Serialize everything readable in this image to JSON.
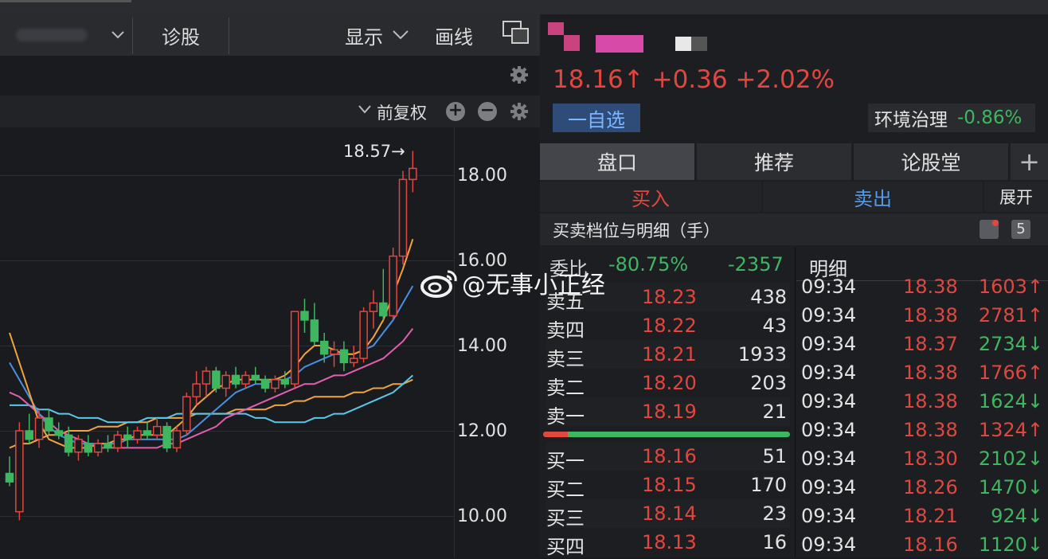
{
  "toolbar": {
    "stock_select": "",
    "diagnose": "诊股",
    "display": "显示",
    "draw": "画线"
  },
  "chart": {
    "adjust_mode": "前复权",
    "high_marker": "18.57→",
    "price_labels": [
      "18.00",
      "16.00",
      "14.00",
      "12.00",
      "10.00"
    ]
  },
  "chart_data": {
    "type": "candlestick",
    "y_axis_ticks": [
      18.0,
      16.0,
      14.0,
      12.0,
      10.0
    ],
    "high_annotation": 18.57,
    "candles": [
      {
        "o": 11.0,
        "h": 11.4,
        "l": 10.7,
        "c": 10.8
      },
      {
        "o": 10.1,
        "h": 12.2,
        "l": 9.9,
        "c": 12.0
      },
      {
        "o": 12.0,
        "h": 12.4,
        "l": 11.7,
        "c": 11.8
      },
      {
        "o": 11.8,
        "h": 12.5,
        "l": 11.6,
        "c": 12.3
      },
      {
        "o": 12.3,
        "h": 12.5,
        "l": 11.9,
        "c": 12.0
      },
      {
        "o": 12.0,
        "h": 12.2,
        "l": 11.8,
        "c": 11.9
      },
      {
        "o": 11.9,
        "h": 12.1,
        "l": 11.4,
        "c": 11.5
      },
      {
        "o": 11.5,
        "h": 11.9,
        "l": 11.3,
        "c": 11.8
      },
      {
        "o": 11.7,
        "h": 11.9,
        "l": 11.4,
        "c": 11.5
      },
      {
        "o": 11.5,
        "h": 11.8,
        "l": 11.4,
        "c": 11.7
      },
      {
        "o": 11.7,
        "h": 11.9,
        "l": 11.5,
        "c": 11.6
      },
      {
        "o": 11.6,
        "h": 12.0,
        "l": 11.5,
        "c": 11.9
      },
      {
        "o": 11.9,
        "h": 12.1,
        "l": 11.6,
        "c": 11.8
      },
      {
        "o": 11.8,
        "h": 12.1,
        "l": 11.7,
        "c": 12.0
      },
      {
        "o": 12.0,
        "h": 12.2,
        "l": 11.8,
        "c": 11.9
      },
      {
        "o": 11.9,
        "h": 12.3,
        "l": 11.8,
        "c": 12.1
      },
      {
        "o": 12.1,
        "h": 12.2,
        "l": 11.5,
        "c": 11.6
      },
      {
        "o": 11.6,
        "h": 12.1,
        "l": 11.5,
        "c": 12.0
      },
      {
        "o": 12.0,
        "h": 12.9,
        "l": 11.9,
        "c": 12.8
      },
      {
        "o": 12.8,
        "h": 13.4,
        "l": 12.6,
        "c": 13.1
      },
      {
        "o": 13.1,
        "h": 13.5,
        "l": 12.8,
        "c": 13.4
      },
      {
        "o": 13.4,
        "h": 13.5,
        "l": 12.9,
        "c": 13.0
      },
      {
        "o": 13.0,
        "h": 13.4,
        "l": 12.8,
        "c": 13.3
      },
      {
        "o": 13.3,
        "h": 13.5,
        "l": 13.0,
        "c": 13.1
      },
      {
        "o": 13.1,
        "h": 13.4,
        "l": 13.0,
        "c": 13.3
      },
      {
        "o": 13.3,
        "h": 13.5,
        "l": 13.1,
        "c": 13.2
      },
      {
        "o": 13.2,
        "h": 13.3,
        "l": 12.9,
        "c": 13.0
      },
      {
        "o": 13.0,
        "h": 13.3,
        "l": 12.9,
        "c": 13.2
      },
      {
        "o": 13.2,
        "h": 13.4,
        "l": 13.0,
        "c": 13.1
      },
      {
        "o": 13.1,
        "h": 14.8,
        "l": 13.0,
        "c": 14.8
      },
      {
        "o": 14.8,
        "h": 15.1,
        "l": 14.3,
        "c": 14.6
      },
      {
        "o": 14.6,
        "h": 15.0,
        "l": 14.0,
        "c": 14.1
      },
      {
        "o": 14.1,
        "h": 14.3,
        "l": 13.6,
        "c": 13.8
      },
      {
        "o": 13.8,
        "h": 14.1,
        "l": 13.5,
        "c": 13.9
      },
      {
        "o": 13.9,
        "h": 14.1,
        "l": 13.4,
        "c": 13.6
      },
      {
        "o": 13.6,
        "h": 14.0,
        "l": 13.5,
        "c": 13.7
      },
      {
        "o": 13.7,
        "h": 14.9,
        "l": 13.6,
        "c": 14.8
      },
      {
        "o": 14.8,
        "h": 15.3,
        "l": 14.4,
        "c": 15.0
      },
      {
        "o": 15.0,
        "h": 15.8,
        "l": 14.6,
        "c": 14.7
      },
      {
        "o": 14.7,
        "h": 16.3,
        "l": 14.6,
        "c": 16.1
      },
      {
        "o": 16.1,
        "h": 18.1,
        "l": 15.9,
        "c": 17.9
      },
      {
        "o": 17.9,
        "h": 18.57,
        "l": 17.6,
        "c": 18.16
      }
    ],
    "ma_lines": [
      {
        "color": "#f0a341",
        "values": [
          11.6,
          11.7,
          11.7,
          11.8,
          11.9,
          11.9,
          12.0,
          12.0,
          12.0,
          12.1,
          12.1,
          12.1,
          12.2,
          12.2,
          12.2,
          12.3,
          12.3,
          12.3,
          12.3,
          12.4,
          12.4,
          12.4,
          12.4,
          12.5,
          12.5,
          12.5,
          12.5,
          12.6,
          12.6,
          12.7,
          12.7,
          12.8,
          12.8,
          12.8,
          12.8,
          12.9,
          12.9,
          13.0,
          13.0,
          13.1,
          13.1,
          13.2
        ]
      },
      {
        "color": "#5ac8e8",
        "values": [
          12.6,
          12.6,
          12.6,
          12.5,
          12.5,
          12.4,
          12.4,
          12.3,
          12.3,
          12.3,
          12.2,
          12.2,
          12.2,
          12.2,
          12.3,
          12.3,
          12.3,
          12.4,
          12.4,
          12.4,
          12.4,
          12.4,
          12.4,
          12.4,
          12.4,
          12.3,
          12.3,
          12.2,
          12.2,
          12.2,
          12.2,
          12.3,
          12.3,
          12.4,
          12.4,
          12.5,
          12.6,
          12.7,
          12.8,
          12.9,
          13.1,
          13.3
        ]
      },
      {
        "color": "#e05fb0",
        "values": [
          12.9,
          12.8,
          12.6,
          12.4,
          12.2,
          12.0,
          11.9,
          11.8,
          11.7,
          11.6,
          11.6,
          11.6,
          11.6,
          11.6,
          11.6,
          11.6,
          11.7,
          11.7,
          11.8,
          11.9,
          12.0,
          12.1,
          12.3,
          12.4,
          12.5,
          12.6,
          12.7,
          12.8,
          12.9,
          13.0,
          13.1,
          13.1,
          13.2,
          13.3,
          13.3,
          13.4,
          13.5,
          13.6,
          13.7,
          13.9,
          14.1,
          14.4
        ]
      },
      {
        "color": "#4a90e2",
        "values": [
          13.6,
          13.2,
          12.8,
          12.4,
          12.1,
          11.9,
          11.8,
          11.7,
          11.7,
          11.7,
          11.7,
          11.7,
          11.8,
          11.8,
          11.8,
          11.8,
          11.8,
          11.8,
          11.9,
          12.1,
          12.3,
          12.5,
          12.7,
          12.9,
          13.0,
          13.1,
          13.1,
          13.2,
          13.2,
          13.3,
          13.5,
          13.6,
          13.7,
          13.8,
          13.8,
          13.8,
          13.9,
          14.0,
          14.3,
          14.6,
          15.0,
          15.4
        ]
      },
      {
        "color": "#f0a341",
        "values": [
          14.3,
          13.6,
          12.9,
          12.2,
          11.8,
          11.7,
          11.6,
          11.6,
          11.6,
          11.7,
          11.7,
          11.8,
          11.8,
          11.9,
          11.9,
          11.9,
          11.9,
          12.1,
          12.3,
          12.6,
          12.8,
          13.0,
          13.1,
          13.2,
          13.2,
          13.2,
          13.2,
          13.2,
          13.3,
          13.5,
          13.8,
          14.0,
          14.0,
          13.9,
          13.8,
          13.8,
          13.9,
          14.2,
          14.6,
          15.2,
          15.8,
          16.5
        ]
      }
    ]
  },
  "quote": {
    "price": "18.16↑",
    "change": "+0.36",
    "change_pct": "+2.02%",
    "watchlist_button": "一自选",
    "sector_name": "环境治理",
    "sector_change": "-0.86%"
  },
  "tabs": [
    "盘口",
    "推荐",
    "论股堂"
  ],
  "trade": {
    "buy": "买入",
    "sell": "卖出",
    "expand": "展开"
  },
  "order_book": {
    "title": "买卖档位与明细（手）",
    "level_count": "5",
    "weibi_label": "委比",
    "weibi_pct": "-80.75%",
    "weibi_value": "-2357",
    "asks": [
      {
        "label": "卖五",
        "price": "18.23",
        "vol": "438"
      },
      {
        "label": "卖四",
        "price": "18.22",
        "vol": "43"
      },
      {
        "label": "卖三",
        "price": "18.21",
        "vol": "1933"
      },
      {
        "label": "卖二",
        "price": "18.20",
        "vol": "203"
      },
      {
        "label": "卖一",
        "price": "18.19",
        "vol": "21"
      }
    ],
    "bids": [
      {
        "label": "买一",
        "price": "18.16",
        "vol": "51"
      },
      {
        "label": "买二",
        "price": "18.15",
        "vol": "170"
      },
      {
        "label": "买三",
        "price": "18.14",
        "vol": "23"
      },
      {
        "label": "买四",
        "price": "18.13",
        "vol": "16"
      }
    ],
    "bid_ratio": 0.1
  },
  "detail": {
    "title": "明细",
    "rows": [
      {
        "time": "09:34",
        "price": "18.38",
        "vol": "1603↑",
        "dir": "up"
      },
      {
        "time": "09:34",
        "price": "18.38",
        "vol": "2781↑",
        "dir": "up"
      },
      {
        "time": "09:34",
        "price": "18.37",
        "vol": "2734↓",
        "dir": "down"
      },
      {
        "time": "09:34",
        "price": "18.38",
        "vol": "1766↑",
        "dir": "up"
      },
      {
        "time": "09:34",
        "price": "18.38",
        "vol": "1624↓",
        "dir": "down"
      },
      {
        "time": "09:34",
        "price": "18.38",
        "vol": "1324↑",
        "dir": "up"
      },
      {
        "time": "09:34",
        "price": "18.30",
        "vol": "2102↓",
        "dir": "down"
      },
      {
        "time": "09:34",
        "price": "18.26",
        "vol": "1470↓",
        "dir": "down"
      },
      {
        "time": "09:34",
        "price": "18.21",
        "vol": "924↓",
        "dir": "down"
      },
      {
        "time": "09:34",
        "price": "18.16",
        "vol": "1120↓",
        "dir": "down"
      }
    ]
  },
  "watermark": "@无事小正经",
  "colors": {
    "up": "#e0473f",
    "down": "#3fb660",
    "bg": "#1a1b1f",
    "panel": "#2c2d31"
  }
}
